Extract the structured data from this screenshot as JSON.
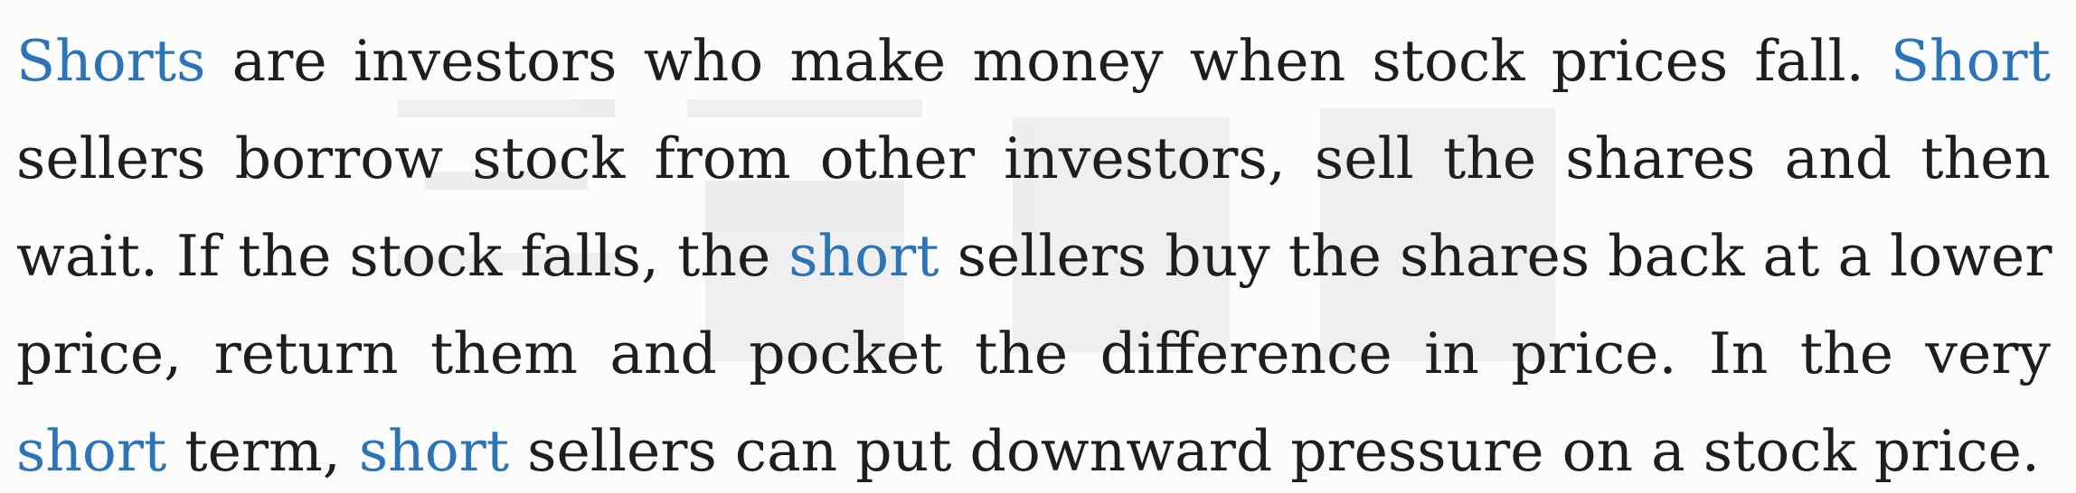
{
  "paragraph": {
    "lines": [
      [
        {
          "text": "Shorts",
          "highlight": true
        },
        {
          "text": " are investors who make money when stock prices fall. ",
          "highlight": false
        },
        {
          "text": "Short",
          "highlight": true
        }
      ],
      [
        {
          "text": "sellers borrow stock from other investors, sell the shares and then",
          "highlight": false
        }
      ],
      [
        {
          "text": "wait. If the stock falls, the ",
          "highlight": false
        },
        {
          "text": "short",
          "highlight": true
        },
        {
          "text": " sellers buy the shares back at a lower",
          "highlight": false
        }
      ],
      [
        {
          "text": "price, return them and pocket the difference in price. In the very",
          "highlight": false
        }
      ],
      [
        {
          "text": "short",
          "highlight": true
        },
        {
          "text": " term, ",
          "highlight": false
        },
        {
          "text": "short",
          "highlight": true
        },
        {
          "text": " sellers can put downward pressure on a stock price.",
          "highlight": false
        }
      ]
    ]
  },
  "colors": {
    "text": "#1e1e1e",
    "highlight": "#2c74b8",
    "background": "#fcfcfc"
  }
}
